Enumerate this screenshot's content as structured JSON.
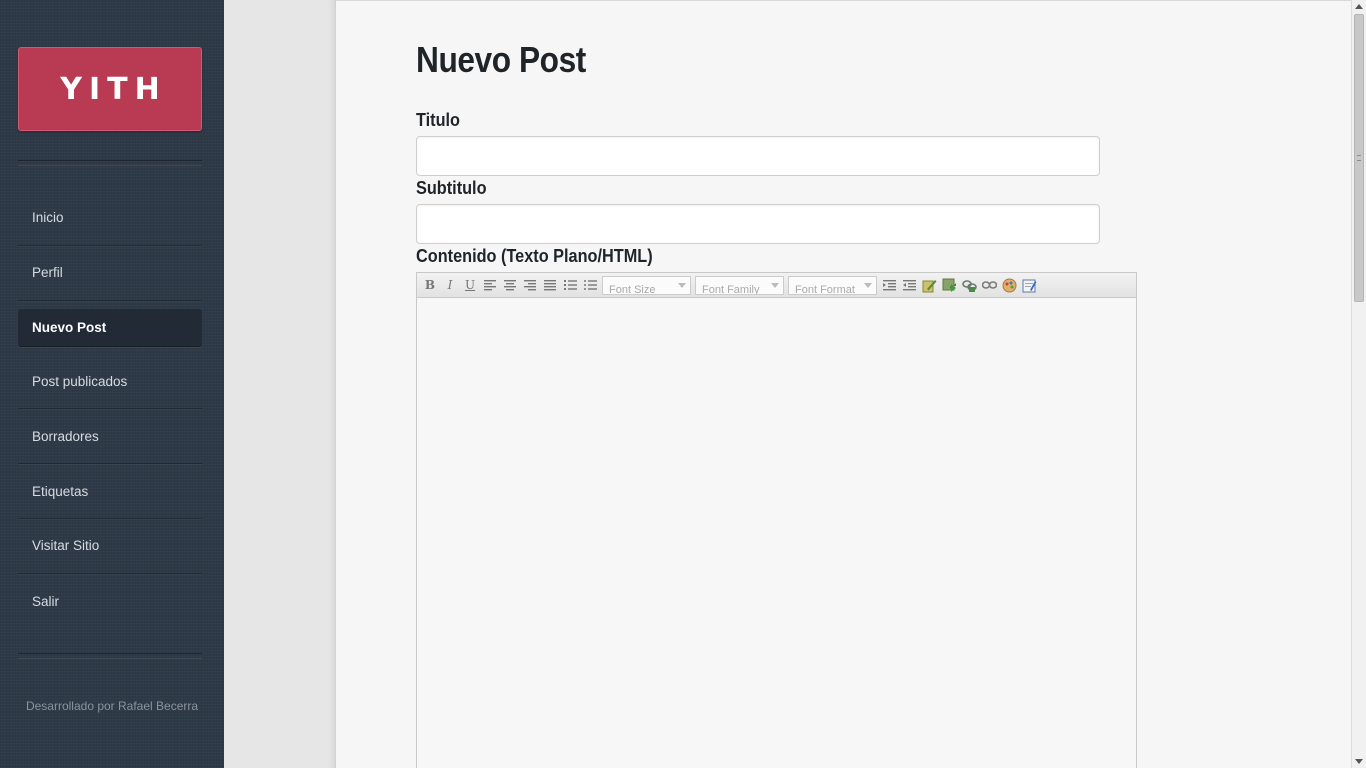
{
  "sidebar": {
    "logo_text": "YITH",
    "items": [
      {
        "label": "Inicio"
      },
      {
        "label": "Perfil"
      },
      {
        "label": "Nuevo Post",
        "active": true
      },
      {
        "label": "Post publicados"
      },
      {
        "label": "Borradores"
      },
      {
        "label": "Etiquetas"
      },
      {
        "label": "Visitar Sitio"
      },
      {
        "label": "Salir"
      }
    ],
    "credit": "Desarrollado por Rafael Becerra"
  },
  "main": {
    "title": "Nuevo Post",
    "fields": {
      "titulo": {
        "label": "Titulo",
        "value": "",
        "placeholder": ""
      },
      "subtitulo": {
        "label": "Subtitulo",
        "value": "",
        "placeholder": ""
      },
      "contenido": {
        "label": "Contenido (Texto Plano/HTML)"
      }
    },
    "editor": {
      "buttons": [
        "bold",
        "italic",
        "underline",
        "align-left",
        "align-center",
        "align-right",
        "align-justify",
        "ordered-list",
        "unordered-list"
      ],
      "selects": {
        "font_size": "Font Size",
        "font_family": "Font Family",
        "font_format": "Font Format"
      },
      "tools": [
        "outdent",
        "indent",
        "highlight",
        "insert-image",
        "link",
        "unlink",
        "color",
        "edit-html"
      ],
      "content": ""
    }
  },
  "colors": {
    "sidebar_bg": "#2f3a48",
    "logo_bg": "#b83a53",
    "active_item_bg": "#212a35"
  }
}
